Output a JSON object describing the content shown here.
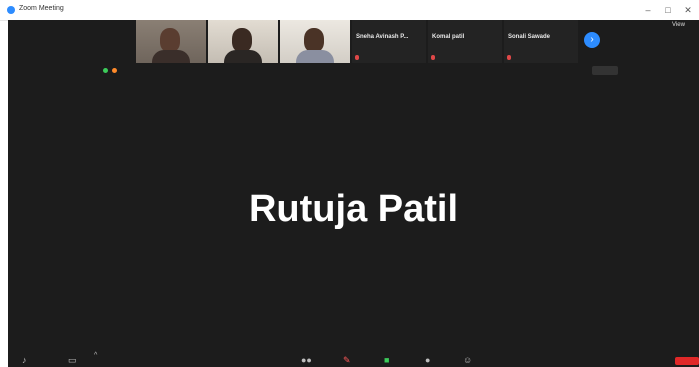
{
  "window": {
    "title": "Zoom Meeting"
  },
  "video_strip": [
    {
      "caption": "",
      "bg": "#8a7f74",
      "wall": "#b0a79c"
    },
    {
      "caption": "",
      "bg": "#c9c2b8",
      "wall": "#e2dcd2"
    },
    {
      "caption": "",
      "bg": "#d5d0c8",
      "wall": "#ece8e1"
    }
  ],
  "name_tiles": [
    {
      "name": "Sneha Avinash P..."
    },
    {
      "name": "Komal patil"
    },
    {
      "name": "Sonali Sawade"
    }
  ],
  "status": {
    "label": ""
  },
  "top_right": {
    "view_label": "View",
    "stop_label": ""
  },
  "active_speaker": {
    "name": "Rutuja Patil"
  },
  "colors": {
    "accent": "#2d8cff",
    "end": "#e02828",
    "background": "#1c1c1c"
  }
}
